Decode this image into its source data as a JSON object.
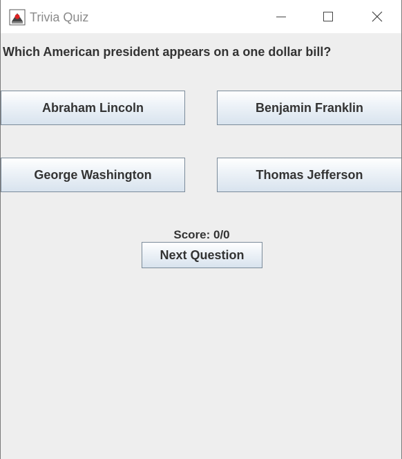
{
  "window": {
    "title": "Trivia Quiz",
    "icon": "java-cup-icon",
    "controls": [
      "minimize-icon",
      "maximize-icon",
      "close-icon"
    ]
  },
  "quiz": {
    "question": "Which American president appears on a one dollar bill?",
    "answers": [
      "Abraham Lincoln",
      "Benjamin Franklin",
      "George Washington",
      "Thomas Jefferson"
    ],
    "score_text": "Score: 0/0",
    "next_label": "Next Question"
  }
}
